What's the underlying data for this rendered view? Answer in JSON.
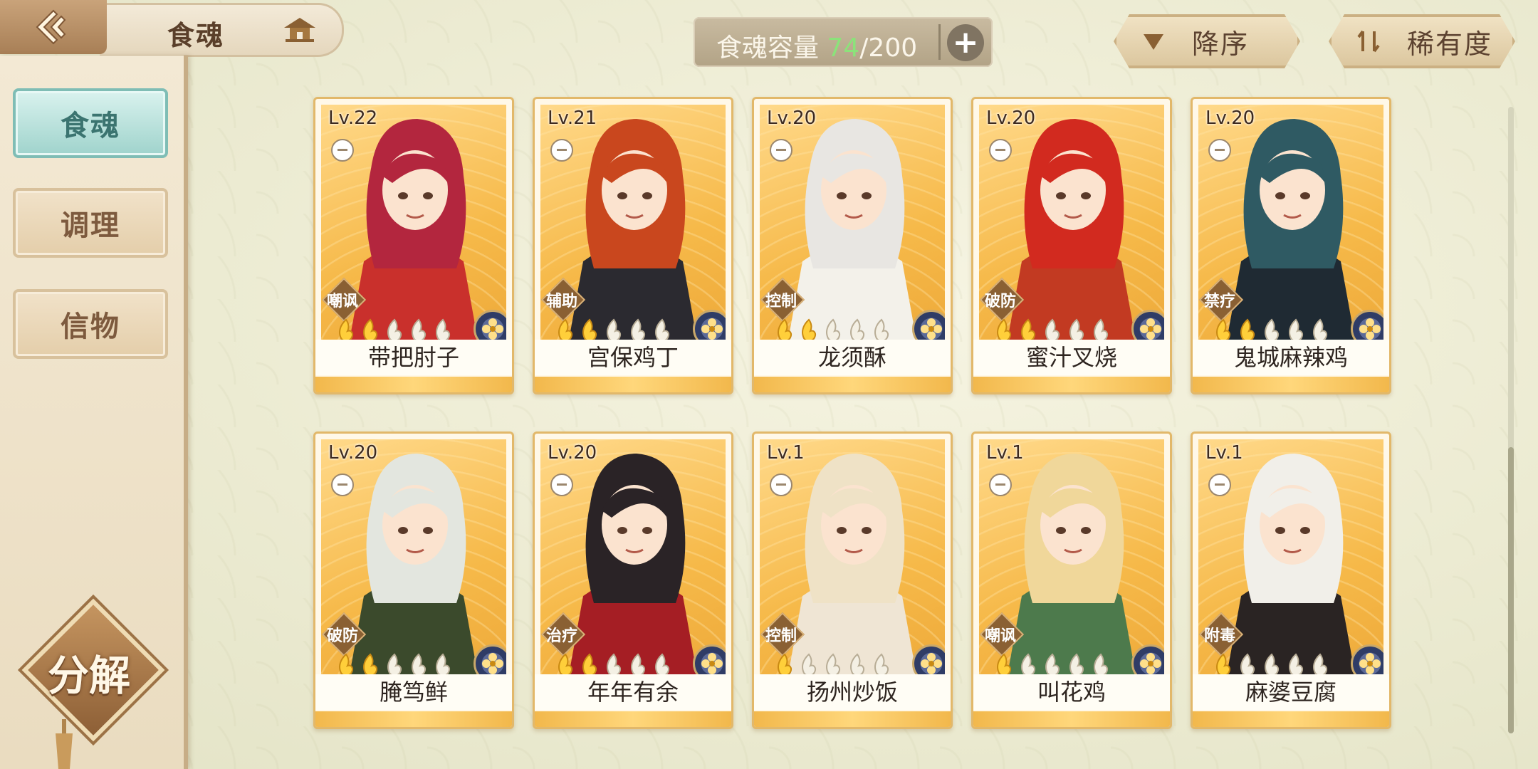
{
  "header": {
    "title": "食魂"
  },
  "sidebar": {
    "items": [
      {
        "label": "食魂",
        "active": true
      },
      {
        "label": "调理",
        "active": false
      },
      {
        "label": "信物",
        "active": false
      }
    ],
    "decompose_label": "分解"
  },
  "capacity": {
    "label": "食魂容量",
    "current": "74",
    "max": "/200",
    "plus": "+"
  },
  "sort": {
    "order_label": "降序",
    "rarity_label": "稀有度"
  },
  "colors": {
    "accent_green": "#8be37a",
    "card_gold": "#f6b949",
    "active_tab": "#9fd3cc"
  },
  "cards": [
    {
      "level": "Lv.22",
      "role": "嘲讽",
      "name": "带把肘子",
      "stars_filled": 2,
      "hair": "#b3263e",
      "outfit": "#c9302c"
    },
    {
      "level": "Lv.21",
      "role": "辅助",
      "name": "宫保鸡丁",
      "stars_filled": 2,
      "hair": "#c9471e",
      "outfit": "#2b2a30"
    },
    {
      "level": "Lv.20",
      "role": "控制",
      "name": "龙须酥",
      "stars_filled": 2,
      "hair": "#e8e6e2",
      "outfit": "#f3f1ea"
    },
    {
      "level": "Lv.20",
      "role": "破防",
      "name": "蜜汁叉烧",
      "stars_filled": 2,
      "hair": "#d22a1f",
      "outfit": "#c23a22"
    },
    {
      "level": "Lv.20",
      "role": "禁疗",
      "name": "鬼城麻辣鸡",
      "stars_filled": 2,
      "hair": "#2f5a63",
      "outfit": "#1f2a33"
    },
    {
      "level": "Lv.20",
      "role": "破防",
      "name": "腌笃鲜",
      "stars_filled": 2,
      "hair": "#e3e6df",
      "outfit": "#3b4a2c"
    },
    {
      "level": "Lv.20",
      "role": "治疗",
      "name": "年年有余",
      "stars_filled": 2,
      "hair": "#2a2326",
      "outfit": "#a51e24"
    },
    {
      "level": "Lv.1",
      "role": "控制",
      "name": "扬州炒饭",
      "stars_filled": 1,
      "hair": "#efe2c6",
      "outfit": "#efe5d4"
    },
    {
      "level": "Lv.1",
      "role": "嘲讽",
      "name": "叫花鸡",
      "stars_filled": 1,
      "hair": "#f0d79a",
      "outfit": "#4d7a4c"
    },
    {
      "level": "Lv.1",
      "role": "附毒",
      "name": "麻婆豆腐",
      "stars_filled": 1,
      "hair": "#f1efe9",
      "outfit": "#2a2423"
    }
  ]
}
